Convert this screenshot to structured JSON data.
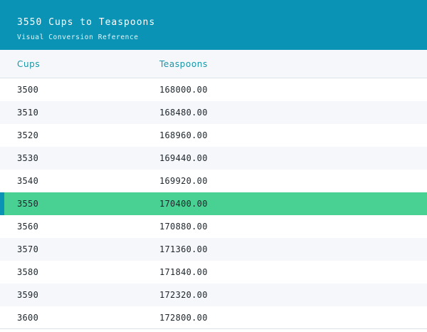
{
  "header": {
    "title": "3550 Cups to Teaspoons",
    "subtitle": "Visual Conversion Reference"
  },
  "columns": {
    "cups": "Cups",
    "teaspoons": "Teaspoons"
  },
  "colors": {
    "header_bg": "#0a93b5",
    "highlight_row": "#48d193",
    "highlight_marker": "#0a93b5",
    "column_header_text": "#1596a8"
  },
  "rows": [
    {
      "cups": "3500",
      "teaspoons": "168000.00"
    },
    {
      "cups": "3510",
      "teaspoons": "168480.00"
    },
    {
      "cups": "3520",
      "teaspoons": "168960.00"
    },
    {
      "cups": "3530",
      "teaspoons": "169440.00"
    },
    {
      "cups": "3540",
      "teaspoons": "169920.00"
    },
    {
      "cups": "3550",
      "teaspoons": "170400.00",
      "highlighted": true
    },
    {
      "cups": "3560",
      "teaspoons": "170880.00"
    },
    {
      "cups": "3570",
      "teaspoons": "171360.00"
    },
    {
      "cups": "3580",
      "teaspoons": "171840.00"
    },
    {
      "cups": "3590",
      "teaspoons": "172320.00"
    },
    {
      "cups": "3600",
      "teaspoons": "172800.00"
    }
  ]
}
